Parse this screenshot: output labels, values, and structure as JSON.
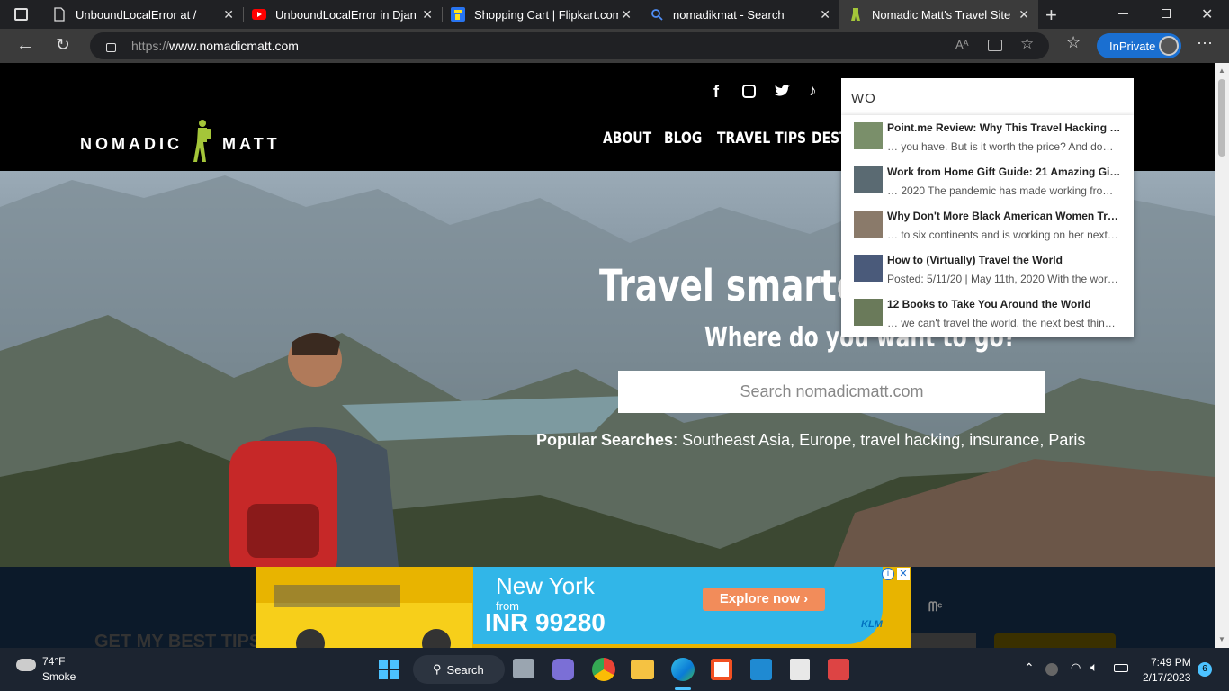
{
  "browser": {
    "tabs": [
      {
        "title": "UnboundLocalError at /",
        "icon": "document-icon"
      },
      {
        "title": "UnboundLocalError in Django",
        "icon": "youtube-icon"
      },
      {
        "title": "Shopping Cart | Flipkart.com",
        "icon": "flipkart-icon"
      },
      {
        "title": "nomadikmat - Search",
        "icon": "search-icon"
      },
      {
        "title": "Nomadic Matt's Travel Site",
        "icon": "nomadic-matt-icon"
      }
    ],
    "url_prefix": "https://",
    "url_host": "www.nomadicmatt.com",
    "inprivate_label": "InPrivate"
  },
  "site": {
    "logo_left": "NOMADIC",
    "logo_right": "MATT",
    "nav": [
      "ABOUT",
      "BLOG",
      "TRAVEL TIPS",
      "DEST"
    ],
    "search_value": "WO",
    "suggestions": [
      {
        "title": "Point.me Review: Why This Travel Hacking …",
        "snippet": "… you have. But is it worth the price? And doe…"
      },
      {
        "title": "Work from Home Gift Guide: 21 Amazing Gi…",
        "snippet": "… 2020 The pandemic has made working fro…"
      },
      {
        "title": "Why Don't More Black American Women Tr…",
        "snippet": "… to six continents and is working on her next…"
      },
      {
        "title": "How to (Virtually) Travel the World",
        "snippet": "Posted: 5/11/20 | May 11th, 2020 With the worl…"
      },
      {
        "title": "12 Books to Take You Around the World",
        "snippet": "… we can't travel the world, the next best thin…"
      }
    ],
    "hero_title": "Travel smarter, c",
    "hero_subtitle": "Where do you want to go?",
    "hero_search_placeholder": "Search nomadicmatt.com",
    "popular_label": "Popular Searches",
    "popular_items": ": Southeast Asia, Europe, travel hacking, insurance, Paris",
    "newsletter_partial": "GET MY BEST TIPS S"
  },
  "ad": {
    "city": "New York",
    "from": "from",
    "price": "INR 99280",
    "cta": "Explore now",
    "brand": "KLM"
  },
  "taskbar": {
    "temp": "74°F",
    "weather": "Smoke",
    "search_label": "Search",
    "time": "7:49 PM",
    "date": "2/17/2023",
    "notifications": "6"
  }
}
